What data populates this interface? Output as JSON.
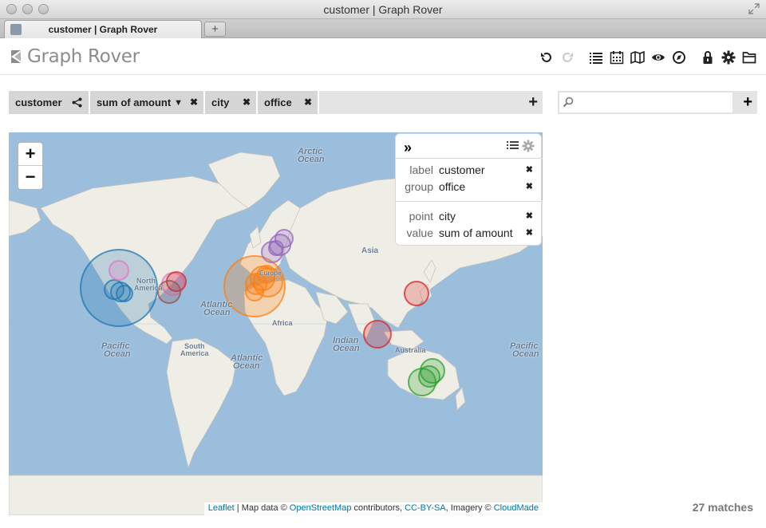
{
  "window": {
    "title": "customer | Graph Rover"
  },
  "tab": {
    "label": "customer | Graph Rover",
    "new_tab_label": "+"
  },
  "app": {
    "logo_text": "Graph Rover"
  },
  "toolbar": {
    "icons": [
      "undo-icon",
      "redo-icon",
      "list-icon",
      "calendar-icon",
      "map-book-icon",
      "eye-icon",
      "compass-icon",
      "lock-icon",
      "gear-icon",
      "folder-icon"
    ]
  },
  "pills": [
    {
      "label": "customer",
      "icon": "share-icon"
    },
    {
      "label": "sum of amount",
      "icon": "caret-down-icon",
      "close": "✖"
    },
    {
      "label": "city",
      "close": "✖"
    },
    {
      "label": "office",
      "close": "✖"
    }
  ],
  "pillbar": {
    "add_label": "+"
  },
  "search": {
    "value": "",
    "placeholder": "",
    "add_label": "+"
  },
  "map": {
    "zoom_in": "+",
    "zoom_out": "−",
    "labels": {
      "arctic": "Arctic",
      "arctic2": "Ocean",
      "asia": "Asia",
      "north": "North",
      "america": "America",
      "europe": "Europe",
      "atlantic_n": "Atlantic",
      "atlantic_n2": "Ocean",
      "africa": "Africa",
      "pacific_w": "Pacific",
      "pacific_w2": "Ocean",
      "south": "South",
      "america2": "America",
      "atlantic_s": "Atlantic",
      "atlantic_s2": "Ocean",
      "indian": "Indian",
      "indian2": "Ocean",
      "australia": "Australia",
      "pacific_e": "Pacific",
      "pacific_e2": "Ocean"
    },
    "attribution": {
      "leaflet": "Leaflet",
      "sep1": " | Map data © ",
      "osm": "OpenStreetMap",
      "sep2": " contributors, ",
      "license": "CC-BY-SA",
      "sep3": ", Imagery © ",
      "imagery": "CloudMade"
    },
    "colors": {
      "water": "#9bbedc",
      "land": "#efeee6",
      "blue": "#1f77b4",
      "orange": "#ff7f0e",
      "purple": "#9467bd",
      "red": "#d62728",
      "pink": "#e377c2",
      "brown": "#8c564b",
      "green": "#2ca02c"
    }
  },
  "panel": {
    "collapse": "»",
    "rows1": [
      {
        "key": "label",
        "value": "customer",
        "close": "✖"
      },
      {
        "key": "group",
        "value": "office",
        "close": "✖"
      }
    ],
    "rows2": [
      {
        "key": "point",
        "value": "city",
        "close": "✖"
      },
      {
        "key": "value",
        "value": "sum of amount",
        "close": "✖"
      }
    ]
  },
  "status": {
    "matches": "27 matches"
  }
}
